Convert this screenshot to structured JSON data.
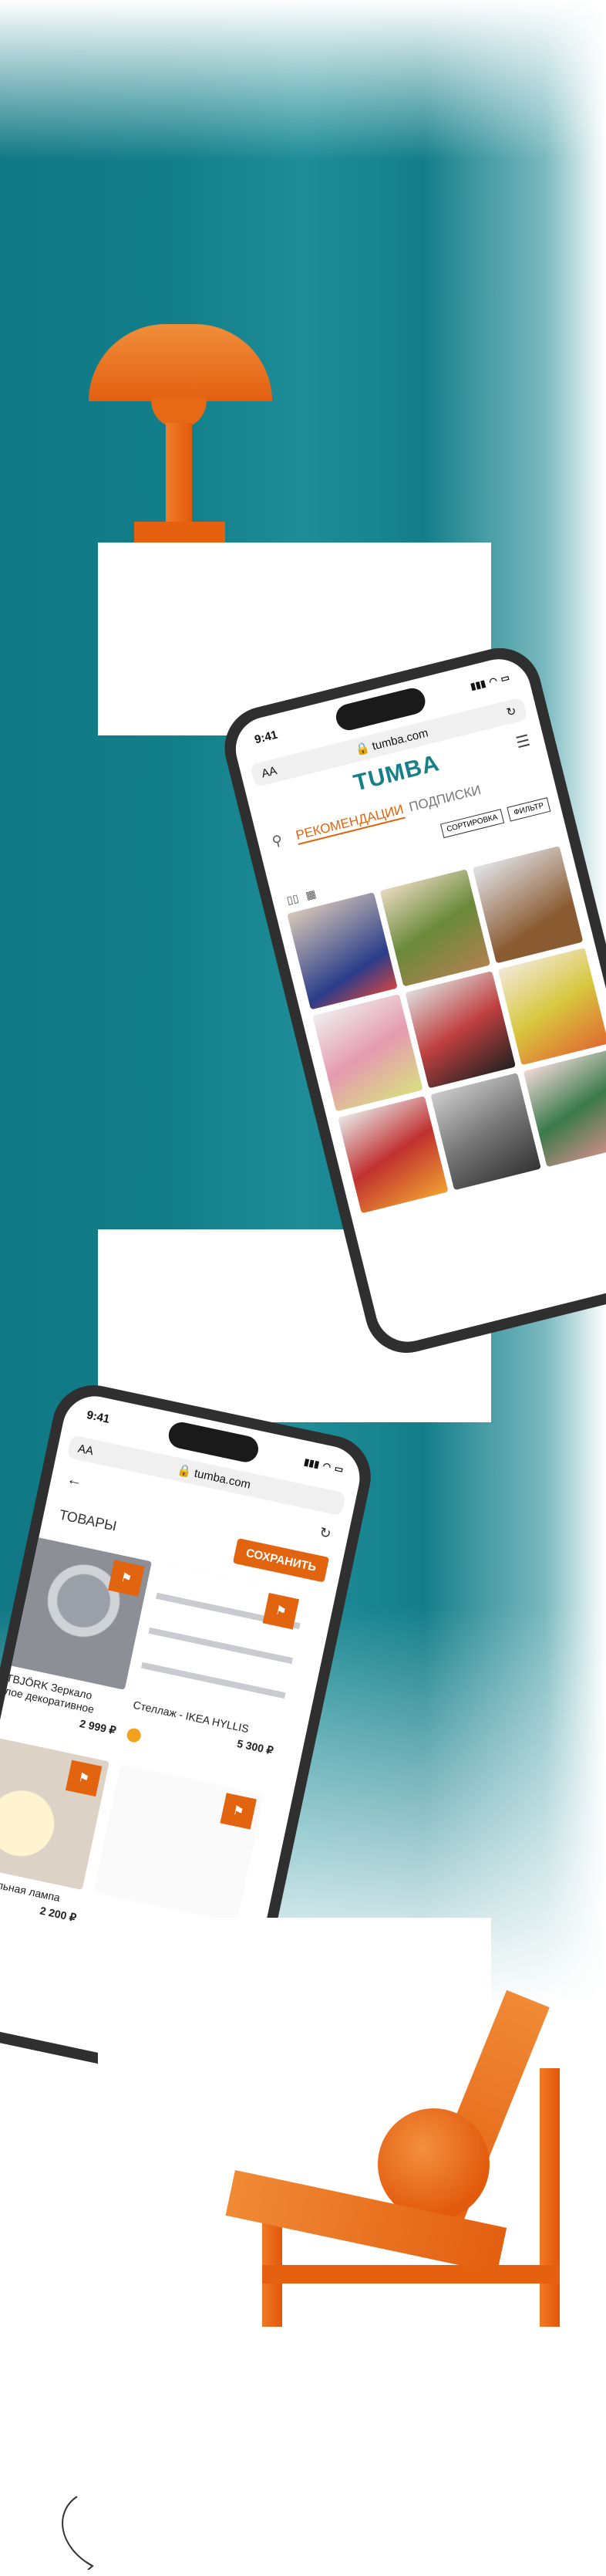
{
  "phone1": {
    "time": "9:41",
    "aa": "AA",
    "url": "tumba.com",
    "logo": "TUMBA",
    "tabs": [
      "РЕКОМЕНДАЦИИ",
      "ПОДПИСКИ"
    ],
    "sort": "СОРТИРОВКА",
    "filter": "ФИЛЬТР"
  },
  "phone2": {
    "time": "9:41",
    "aa": "AA",
    "url": "tumba.com",
    "title": "ТОВАРЫ",
    "save": "СОХРАНИТЬ",
    "products": [
      {
        "name": "SVARTBJÖRK Зеркало выпуклое декоративное",
        "price": "2 999 ₽"
      },
      {
        "name": "Стеллаж - IKEA HYLLIS",
        "price": "5 300 ₽"
      },
      {
        "name": "FADO Настольная лампа",
        "price": "2 200 ₽"
      },
      {
        "name": "",
        "price": ""
      }
    ]
  },
  "colors": {
    "accent": "#e3640f",
    "brand": "#167f8a"
  }
}
